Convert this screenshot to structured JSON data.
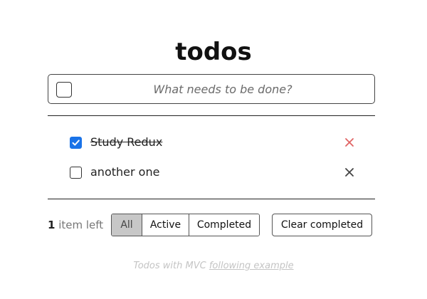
{
  "app": {
    "title": "todos"
  },
  "new_todo": {
    "placeholder": "What needs to be done?",
    "value": "",
    "toggle_all_checked": false
  },
  "todos": [
    {
      "label": "Study Redux",
      "completed": true,
      "delete_color": "#e06464"
    },
    {
      "label": "another one",
      "completed": false,
      "delete_color": "#444444"
    }
  ],
  "footer": {
    "count": "1",
    "count_suffix": "item left",
    "filters": [
      {
        "label": "All",
        "selected": true
      },
      {
        "label": "Active",
        "selected": false
      },
      {
        "label": "Completed",
        "selected": false
      }
    ],
    "clear_completed_label": "Clear completed"
  },
  "info": {
    "text": "Todos with MVC",
    "link_text": "following example"
  },
  "colors": {
    "checkbox_checked": "#1a73e8",
    "filter_selected_bg": "#c7c7c7",
    "delete_highlight": "#e06464",
    "info_text": "#c4c4c4"
  },
  "icons": {
    "delete": "close-icon",
    "check": "checkmark-icon"
  }
}
